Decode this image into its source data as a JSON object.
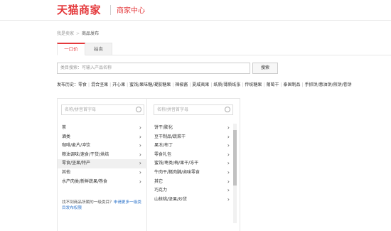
{
  "header": {
    "logo": "天猫商家",
    "center_title": "商家中心"
  },
  "breadcrumb": {
    "home": "我是卖家",
    "separator": ">",
    "current": "商品发布"
  },
  "tabs": [
    {
      "label": "一口价",
      "active": true
    },
    {
      "label": "拍卖",
      "active": false
    }
  ],
  "search": {
    "placeholder": "类目搜索：可输入产品名称",
    "button_label": "搜索"
  },
  "history": {
    "label": "发布历史：",
    "items": [
      "零食",
      "混合坚果",
      "开心果",
      "蜜饯/果味糖/凝胶糖果",
      "辣椒酱",
      "夏威夷果",
      "纸质/薄质纸张",
      "传统糖果",
      "葡萄干",
      "泰国制品",
      "手抓饼/葱油饼/煎饼/卷饼"
    ]
  },
  "category_panel": {
    "left": {
      "search_placeholder": "名称/拼音首字母",
      "items": [
        {
          "label": "茶",
          "selected": false
        },
        {
          "label": "酒类",
          "selected": false
        },
        {
          "label": "咖啡/麦片/冲饮",
          "selected": false
        },
        {
          "label": "粮油调味/速食/干货/烘焙",
          "selected": false
        },
        {
          "label": "零食/坚果/特产",
          "selected": true
        },
        {
          "label": "其他",
          "selected": false
        },
        {
          "label": "水产肉类/新鲜蔬果/熟食",
          "selected": false
        }
      ],
      "not_found_text": "找不到商品所属的一级类目？",
      "not_found_link": "申请更多一级类目发布权限"
    },
    "right": {
      "search_placeholder": "名称/拼音首字母",
      "items": [
        {
          "label": "饼干/膨化"
        },
        {
          "label": "豆干制品/蔬菜干"
        },
        {
          "label": "果冻/布丁"
        },
        {
          "label": "零食礼包"
        },
        {
          "label": "蜜饯/枣类/梅/果干/冻干"
        },
        {
          "label": "牛肉干/猪肉脯/卤味零食"
        },
        {
          "label": "其它"
        },
        {
          "label": "巧克力"
        },
        {
          "label": "山核桃/坚果/炒货"
        }
      ]
    }
  },
  "colors": {
    "brand_red": "#e4393c",
    "link_blue": "#2b72c9",
    "border_gray": "#e6e6e6"
  }
}
